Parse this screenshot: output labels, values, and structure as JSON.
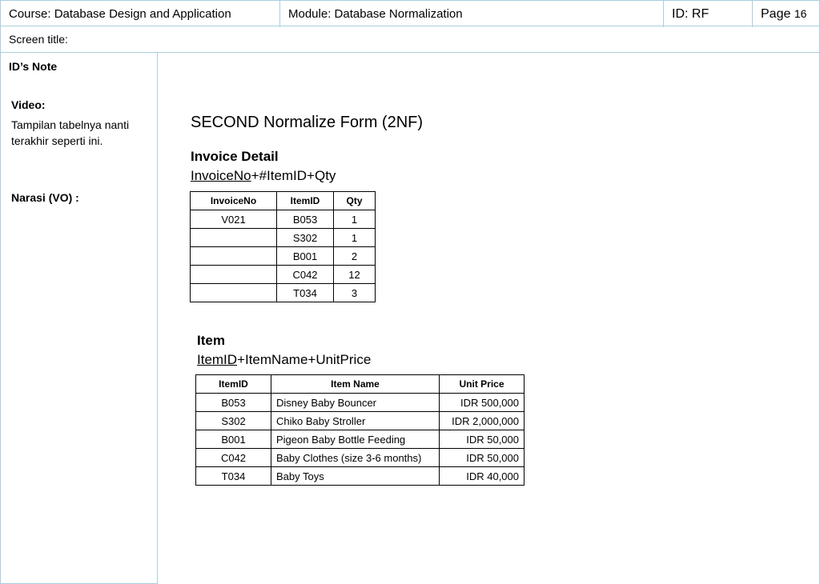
{
  "header": {
    "course": "Course:  Database Design and Application",
    "module": "Module: Database Normalization",
    "id": "ID: RF",
    "page_label": "Page",
    "page_number": "16"
  },
  "screen_title": "Screen title:",
  "sidebar": {
    "heading": "ID’s Note",
    "video_label": "Video:",
    "video_text": "Tampilan tabelnya nanti terakhir seperti ini.",
    "narasi_label": "Narasi (VO) :"
  },
  "main": {
    "title": "SECOND Normalize Form (2NF)",
    "invoice_detail": {
      "heading": "Invoice Detail",
      "formula_key": "InvoiceNo",
      "formula_rest": "+#ItemID+Qty",
      "columns": [
        "InvoiceNo",
        "ItemID",
        "Qty"
      ],
      "rows": [
        [
          "V021",
          "B053",
          "1"
        ],
        [
          "",
          "S302",
          "1"
        ],
        [
          "",
          "B001",
          "2"
        ],
        [
          "",
          "C042",
          "12"
        ],
        [
          "",
          "T034",
          "3"
        ]
      ]
    },
    "item": {
      "heading": "Item",
      "formula_key": "ItemID",
      "formula_rest": "+ItemName+UnitPrice",
      "columns": [
        "ItemID",
        "Item Name",
        "Unit Price"
      ],
      "rows": [
        [
          "B053",
          "Disney Baby Bouncer",
          "IDR 500,000"
        ],
        [
          "S302",
          "Chiko Baby Stroller",
          "IDR 2,000,000"
        ],
        [
          "B001",
          "Pigeon Baby Bottle Feeding",
          "IDR 50,000"
        ],
        [
          "C042",
          "Baby Clothes (size 3-6 months)",
          "IDR 50,000"
        ],
        [
          "T034",
          "Baby Toys",
          "IDR 40,000"
        ]
      ]
    }
  }
}
